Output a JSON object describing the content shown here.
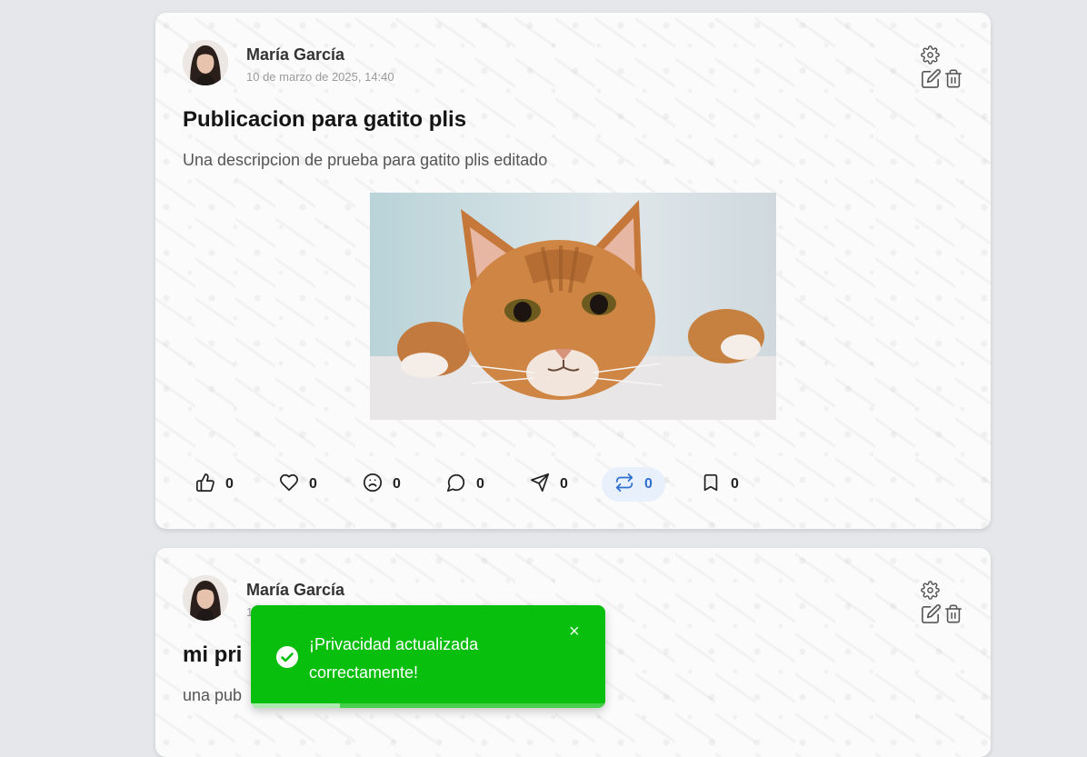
{
  "posts": [
    {
      "author": "María García",
      "date": "10 de marzo de 2025, 14:40",
      "title": "Publicacion para gatito plis",
      "description": "Una descripcion de prueba para gatito plis editado",
      "image_alt": "orange tabby cat",
      "reactions": [
        {
          "icon": "thumbs-up-icon",
          "count": "0"
        },
        {
          "icon": "heart-icon",
          "count": "0"
        },
        {
          "icon": "sad-face-icon",
          "count": "0"
        },
        {
          "icon": "comment-icon",
          "count": "0"
        },
        {
          "icon": "send-icon",
          "count": "0"
        },
        {
          "icon": "repost-icon",
          "count": "0",
          "active": true
        },
        {
          "icon": "bookmark-icon",
          "count": "0"
        }
      ]
    },
    {
      "author": "María García",
      "date": "1",
      "title": "mi pri",
      "description": "una pub"
    }
  ],
  "toast": {
    "message": "¡Privacidad actualizada correctamente!",
    "close": "×",
    "progress": 0.25,
    "color": "#09bf0e"
  },
  "colors": {
    "accent": "#2f6fd0",
    "background": "#e5e7eb"
  }
}
